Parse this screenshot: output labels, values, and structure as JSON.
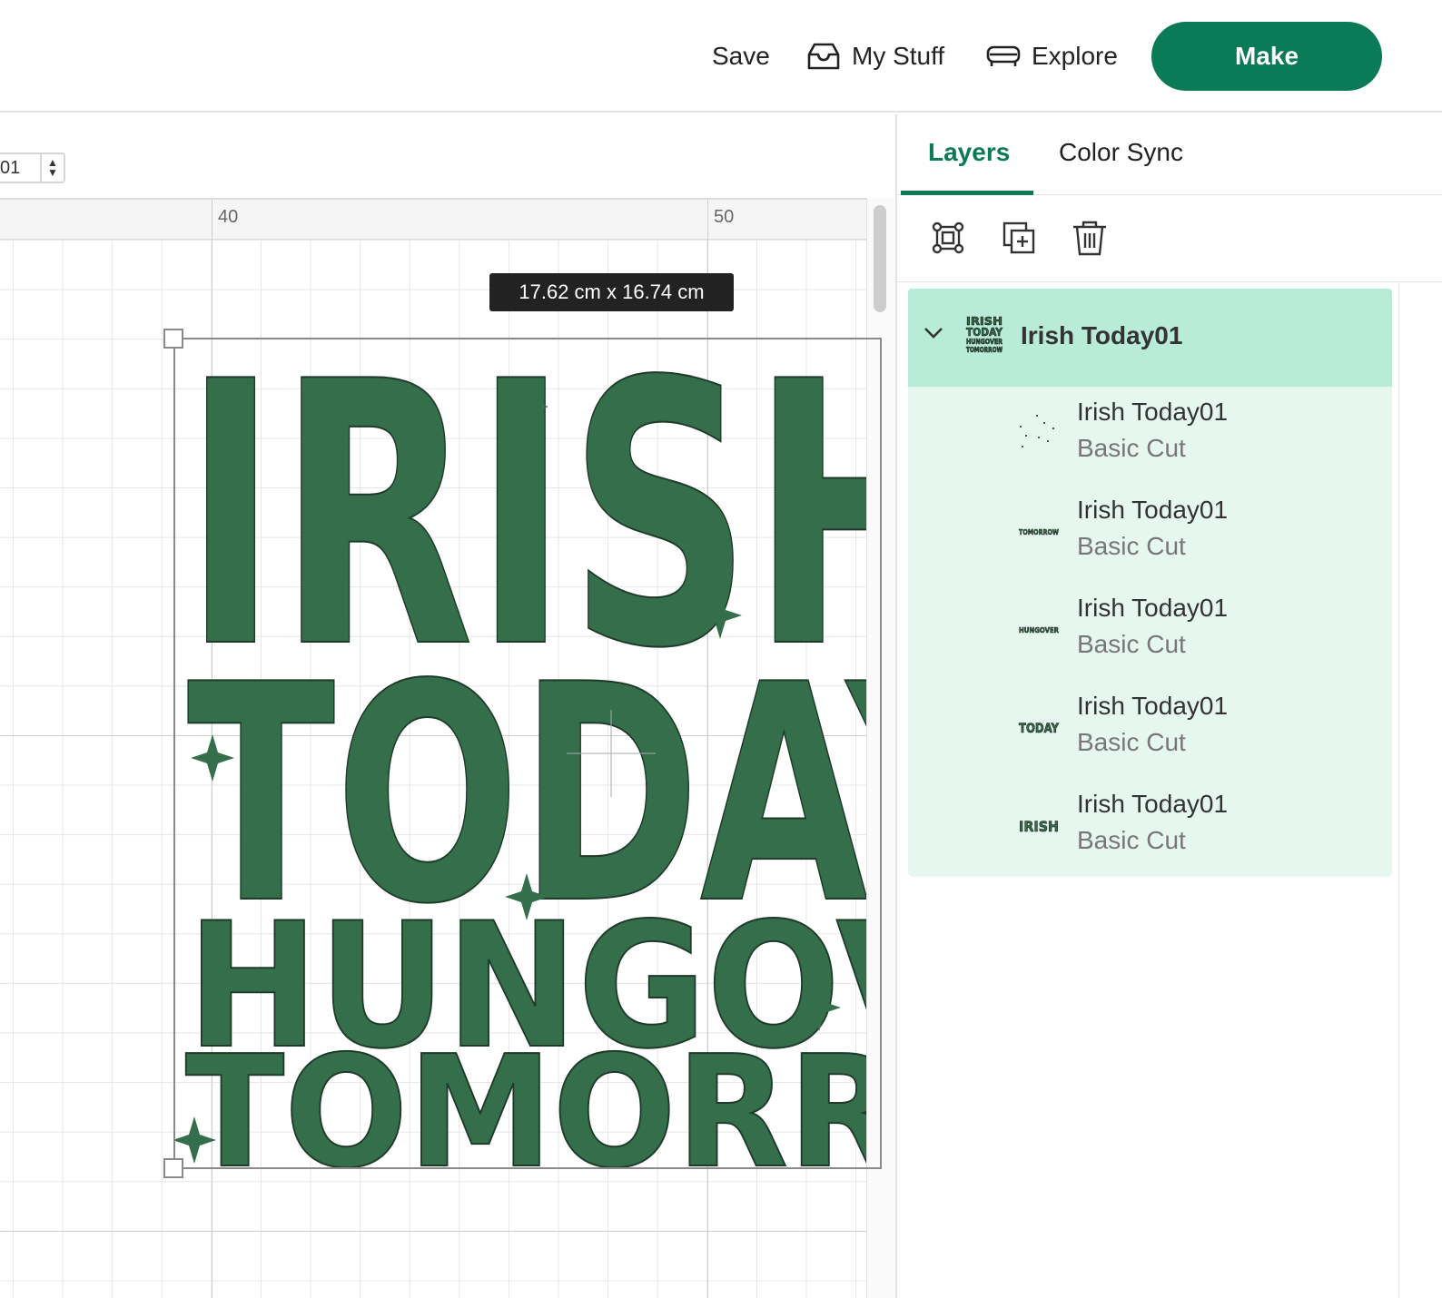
{
  "topbar": {
    "save_label": "Save",
    "mystuff_label": "My Stuff",
    "explore_label": "Explore",
    "make_label": "Make",
    "make_color": "#0b7a56"
  },
  "canvas": {
    "rotate_value": "01",
    "ruler_labels": [
      "40",
      "50"
    ],
    "size_tooltip": "17.62  cm x 16.74  cm",
    "artwork_color": "#356e4b",
    "artwork_lines": [
      "IRISH",
      "TODAY",
      "HUNGOVER",
      "TOMORROW"
    ]
  },
  "panel": {
    "tabs": [
      {
        "label": "Layers",
        "active": true
      },
      {
        "label": "Color Sync",
        "active": false
      }
    ],
    "tools": [
      "group-icon",
      "duplicate-icon",
      "delete-icon"
    ],
    "group": {
      "name": "Irish Today01",
      "expanded": true,
      "highlight_color": "#b9ecd8",
      "thumbnail_text": "IRISH TODAY HUNGOVER TOMORROW"
    },
    "layers": [
      {
        "name": "Irish Today01",
        "operation": "Basic Cut",
        "thumb": "sparkles"
      },
      {
        "name": "Irish Today01",
        "operation": "Basic Cut",
        "thumb": "TOMORROW"
      },
      {
        "name": "Irish Today01",
        "operation": "Basic Cut",
        "thumb": "HUNGOVER"
      },
      {
        "name": "Irish Today01",
        "operation": "Basic Cut",
        "thumb": "TODAY"
      },
      {
        "name": "Irish Today01",
        "operation": "Basic Cut",
        "thumb": "IRISH"
      }
    ]
  }
}
